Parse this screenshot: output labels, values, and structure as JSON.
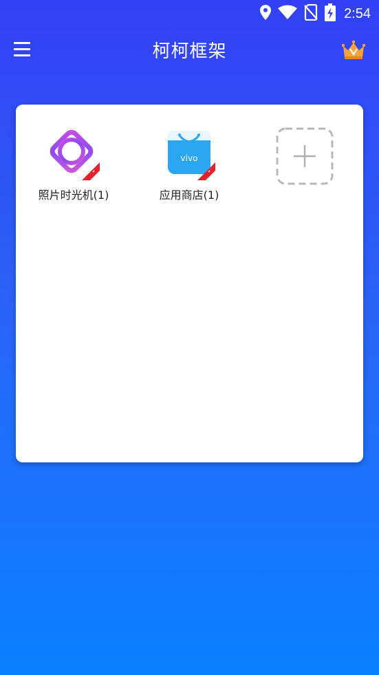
{
  "status_bar": {
    "time": "2:54",
    "icons": [
      "location-icon",
      "wifi-icon",
      "no-sim-icon",
      "battery-charging-icon"
    ]
  },
  "app_bar": {
    "title": "柯柯框架",
    "menu_icon": "hamburger-menu-icon",
    "vip_icon": "crown-icon"
  },
  "apps": [
    {
      "label": "照片时光机(1)",
      "icon": "photo-time-machine-icon"
    },
    {
      "label": "应用商店(1)",
      "icon": "app-store-icon",
      "icon_text": "vivo"
    }
  ],
  "add_slot": {
    "icon": "add-app-icon"
  },
  "colors": {
    "background_top": "#3340f5",
    "background_bottom": "#0a80fc",
    "card": "#ffffff",
    "badge_red": "#e0232d",
    "store_blue": "#2ba6f2",
    "crown_orange": "#f6a33a"
  }
}
